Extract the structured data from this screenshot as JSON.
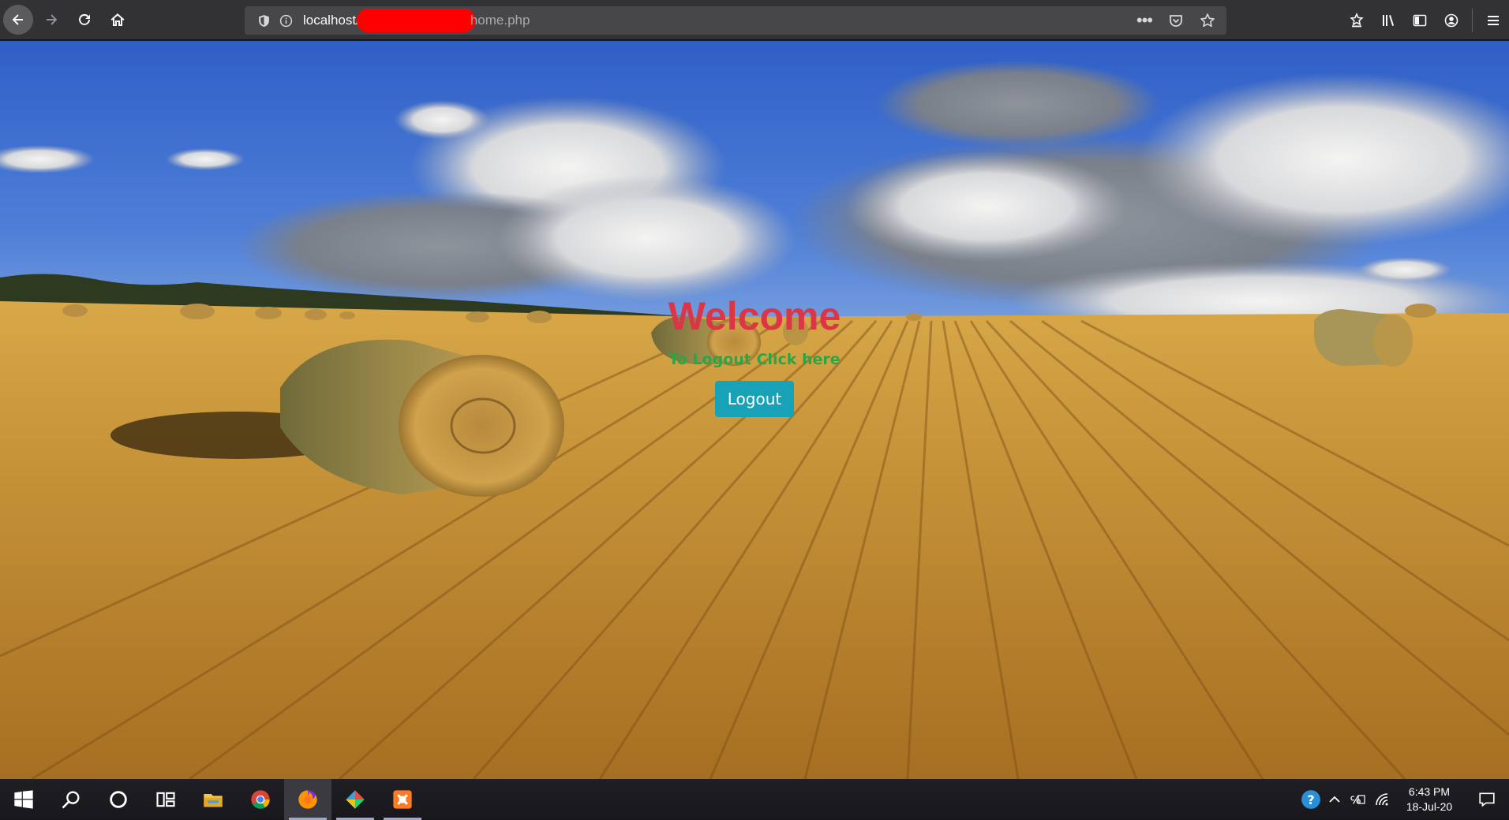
{
  "browser": {
    "url_host": "localhost/",
    "url_path": "home.php"
  },
  "page": {
    "heading": "Welcome",
    "hint": "To Logout Click here",
    "logout_label": "Logout"
  },
  "colors": {
    "heading": "#dc3545",
    "hint": "#28a745",
    "button": "#17a2b8"
  },
  "taskbar": {
    "apps": [
      "start-icon",
      "search-icon",
      "cortana-icon",
      "task-view-icon",
      "file-explorer-icon",
      "chrome-icon",
      "firefox-icon",
      "git-icon",
      "xampp-icon"
    ],
    "clock_time": "6:43 PM",
    "clock_date": "18-Jul-20"
  }
}
